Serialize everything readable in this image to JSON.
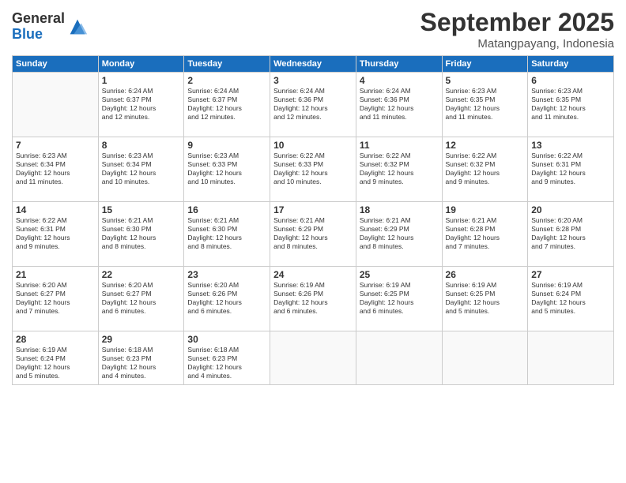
{
  "logo": {
    "general": "General",
    "blue": "Blue"
  },
  "title": "September 2025",
  "location": "Matangpayang, Indonesia",
  "days": [
    "Sunday",
    "Monday",
    "Tuesday",
    "Wednesday",
    "Thursday",
    "Friday",
    "Saturday"
  ],
  "weeks": [
    [
      {
        "day": "",
        "text": ""
      },
      {
        "day": "1",
        "text": "Sunrise: 6:24 AM\nSunset: 6:37 PM\nDaylight: 12 hours\nand 12 minutes."
      },
      {
        "day": "2",
        "text": "Sunrise: 6:24 AM\nSunset: 6:37 PM\nDaylight: 12 hours\nand 12 minutes."
      },
      {
        "day": "3",
        "text": "Sunrise: 6:24 AM\nSunset: 6:36 PM\nDaylight: 12 hours\nand 12 minutes."
      },
      {
        "day": "4",
        "text": "Sunrise: 6:24 AM\nSunset: 6:36 PM\nDaylight: 12 hours\nand 11 minutes."
      },
      {
        "day": "5",
        "text": "Sunrise: 6:23 AM\nSunset: 6:35 PM\nDaylight: 12 hours\nand 11 minutes."
      },
      {
        "day": "6",
        "text": "Sunrise: 6:23 AM\nSunset: 6:35 PM\nDaylight: 12 hours\nand 11 minutes."
      }
    ],
    [
      {
        "day": "7",
        "text": "Sunrise: 6:23 AM\nSunset: 6:34 PM\nDaylight: 12 hours\nand 11 minutes."
      },
      {
        "day": "8",
        "text": "Sunrise: 6:23 AM\nSunset: 6:34 PM\nDaylight: 12 hours\nand 10 minutes."
      },
      {
        "day": "9",
        "text": "Sunrise: 6:23 AM\nSunset: 6:33 PM\nDaylight: 12 hours\nand 10 minutes."
      },
      {
        "day": "10",
        "text": "Sunrise: 6:22 AM\nSunset: 6:33 PM\nDaylight: 12 hours\nand 10 minutes."
      },
      {
        "day": "11",
        "text": "Sunrise: 6:22 AM\nSunset: 6:32 PM\nDaylight: 12 hours\nand 9 minutes."
      },
      {
        "day": "12",
        "text": "Sunrise: 6:22 AM\nSunset: 6:32 PM\nDaylight: 12 hours\nand 9 minutes."
      },
      {
        "day": "13",
        "text": "Sunrise: 6:22 AM\nSunset: 6:31 PM\nDaylight: 12 hours\nand 9 minutes."
      }
    ],
    [
      {
        "day": "14",
        "text": "Sunrise: 6:22 AM\nSunset: 6:31 PM\nDaylight: 12 hours\nand 9 minutes."
      },
      {
        "day": "15",
        "text": "Sunrise: 6:21 AM\nSunset: 6:30 PM\nDaylight: 12 hours\nand 8 minutes."
      },
      {
        "day": "16",
        "text": "Sunrise: 6:21 AM\nSunset: 6:30 PM\nDaylight: 12 hours\nand 8 minutes."
      },
      {
        "day": "17",
        "text": "Sunrise: 6:21 AM\nSunset: 6:29 PM\nDaylight: 12 hours\nand 8 minutes."
      },
      {
        "day": "18",
        "text": "Sunrise: 6:21 AM\nSunset: 6:29 PM\nDaylight: 12 hours\nand 8 minutes."
      },
      {
        "day": "19",
        "text": "Sunrise: 6:21 AM\nSunset: 6:28 PM\nDaylight: 12 hours\nand 7 minutes."
      },
      {
        "day": "20",
        "text": "Sunrise: 6:20 AM\nSunset: 6:28 PM\nDaylight: 12 hours\nand 7 minutes."
      }
    ],
    [
      {
        "day": "21",
        "text": "Sunrise: 6:20 AM\nSunset: 6:27 PM\nDaylight: 12 hours\nand 7 minutes."
      },
      {
        "day": "22",
        "text": "Sunrise: 6:20 AM\nSunset: 6:27 PM\nDaylight: 12 hours\nand 6 minutes."
      },
      {
        "day": "23",
        "text": "Sunrise: 6:20 AM\nSunset: 6:26 PM\nDaylight: 12 hours\nand 6 minutes."
      },
      {
        "day": "24",
        "text": "Sunrise: 6:19 AM\nSunset: 6:26 PM\nDaylight: 12 hours\nand 6 minutes."
      },
      {
        "day": "25",
        "text": "Sunrise: 6:19 AM\nSunset: 6:25 PM\nDaylight: 12 hours\nand 6 minutes."
      },
      {
        "day": "26",
        "text": "Sunrise: 6:19 AM\nSunset: 6:25 PM\nDaylight: 12 hours\nand 5 minutes."
      },
      {
        "day": "27",
        "text": "Sunrise: 6:19 AM\nSunset: 6:24 PM\nDaylight: 12 hours\nand 5 minutes."
      }
    ],
    [
      {
        "day": "28",
        "text": "Sunrise: 6:19 AM\nSunset: 6:24 PM\nDaylight: 12 hours\nand 5 minutes."
      },
      {
        "day": "29",
        "text": "Sunrise: 6:18 AM\nSunset: 6:23 PM\nDaylight: 12 hours\nand 4 minutes."
      },
      {
        "day": "30",
        "text": "Sunrise: 6:18 AM\nSunset: 6:23 PM\nDaylight: 12 hours\nand 4 minutes."
      },
      {
        "day": "",
        "text": ""
      },
      {
        "day": "",
        "text": ""
      },
      {
        "day": "",
        "text": ""
      },
      {
        "day": "",
        "text": ""
      }
    ]
  ]
}
